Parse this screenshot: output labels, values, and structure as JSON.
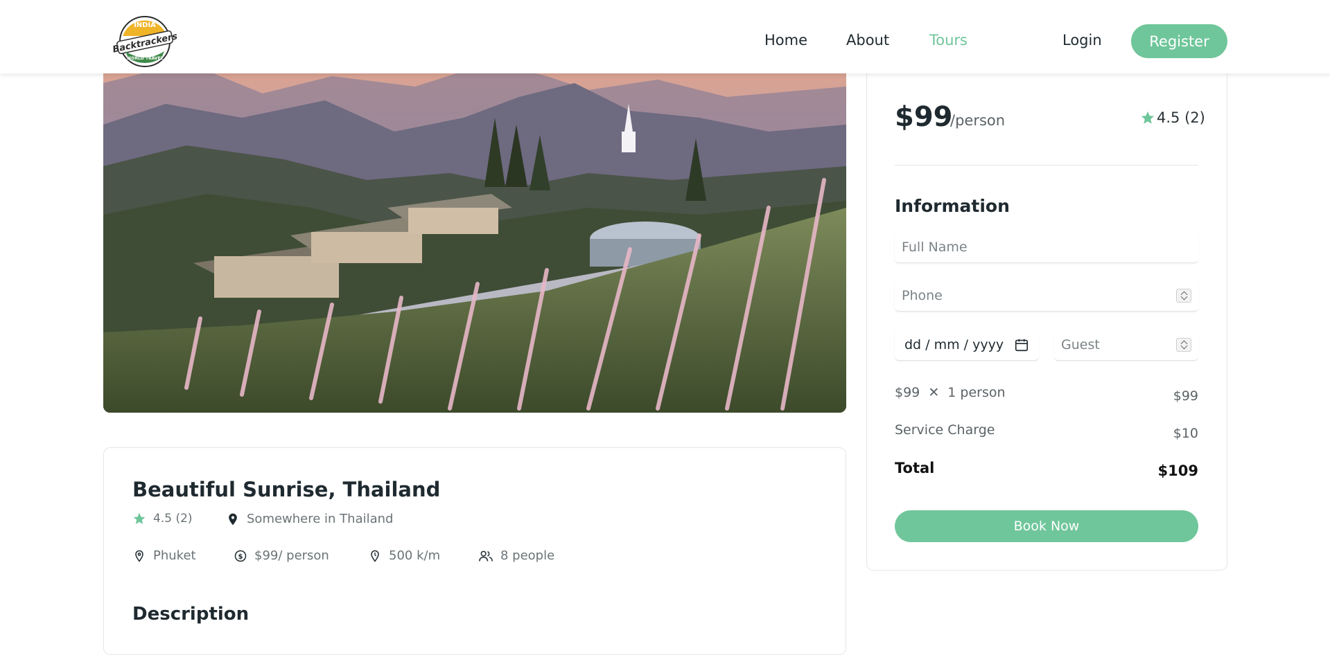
{
  "nav": {
    "logo_alt": "India Backtrackers World Travel",
    "logo_top_text": "INDIA",
    "logo_main_text": "Backtrackers",
    "logo_bottom_text": "WORLD TRAVEL",
    "links": [
      "Home",
      "About",
      "Tours"
    ],
    "active": "Tours",
    "login": "Login",
    "register": "Register"
  },
  "tour": {
    "title": "Beautiful Sunrise, Thailand",
    "rating": "4.5 (2)",
    "address": "Somewhere in Thailand",
    "city": "Phuket",
    "price": "$99/ person",
    "distance": "500 k/m",
    "group_size": "8 people",
    "description_heading": "Description"
  },
  "booking": {
    "price": "$99",
    "price_unit": "/person",
    "rating": "4.5 (2)",
    "info_heading": "Information",
    "full_name_placeholder": "Full Name",
    "phone_placeholder": "Phone",
    "date_placeholder": "dd / mm / yyyy",
    "guest_placeholder": "Guest",
    "line_item_price": "$99",
    "line_item_multiplier": "1 person",
    "line_item_total": "$99",
    "service_label": "Service Charge",
    "service_value": "$10",
    "total_label": "Total",
    "total_value": "$109",
    "book_button": "Book Now"
  },
  "colors": {
    "accent": "#6fc69a",
    "text_dark": "#1f2a30",
    "text_muted": "#6b7376"
  },
  "icons": [
    "star-icon",
    "map-pin-icon",
    "location-icon",
    "dollar-circle-icon",
    "map-marker-distance-icon",
    "group-icon",
    "calendar-icon",
    "close-multiply-icon"
  ]
}
